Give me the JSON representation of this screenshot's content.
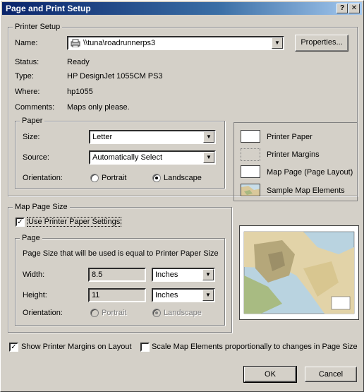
{
  "window": {
    "title": "Page and Print Setup",
    "help_glyph": "?",
    "close_glyph": "✕"
  },
  "printer_setup": {
    "label": "Printer Setup",
    "name_label": "Name:",
    "name_value": "\\\\tuna\\roadrunnerps3",
    "properties_button": "Properties...",
    "status_label": "Status:",
    "status_value": "Ready",
    "type_label": "Type:",
    "type_value": "HP DesignJet 1055CM PS3",
    "where_label": "Where:",
    "where_value": "hp1055",
    "comments_label": "Comments:",
    "comments_value": "Maps only please."
  },
  "paper": {
    "label": "Paper",
    "size_label": "Size:",
    "size_value": "Letter",
    "source_label": "Source:",
    "source_value": "Automatically Select",
    "orientation_label": "Orientation:",
    "portrait_label": "Portrait",
    "landscape_label": "Landscape",
    "selected": "landscape"
  },
  "legend": {
    "printer_paper": "Printer Paper",
    "printer_margins": "Printer Margins",
    "map_page": "Map Page (Page Layout)",
    "sample_map": "Sample Map Elements"
  },
  "map_page_size": {
    "label": "Map Page Size",
    "use_printer_settings": "Use Printer Paper Settings",
    "use_printer_checked": true,
    "page_label": "Page",
    "page_info": "Page Size that will be used is equal to Printer Paper Size",
    "width_label": "Width:",
    "width_value": "8.5",
    "width_unit": "Inches",
    "height_label": "Height:",
    "height_value": "11",
    "height_unit": "Inches",
    "orientation_label": "Orientation:",
    "portrait_label": "Portrait",
    "landscape_label": "Landscape"
  },
  "options": {
    "show_margins": "Show Printer Margins on Layout",
    "show_margins_checked": true,
    "scale_elements": "Scale Map Elements proportionally to changes in Page Size",
    "scale_checked": false
  },
  "buttons": {
    "ok": "OK",
    "cancel": "Cancel"
  },
  "colors": {
    "titlebar": "#0a246a",
    "face": "#d4d0c8"
  }
}
